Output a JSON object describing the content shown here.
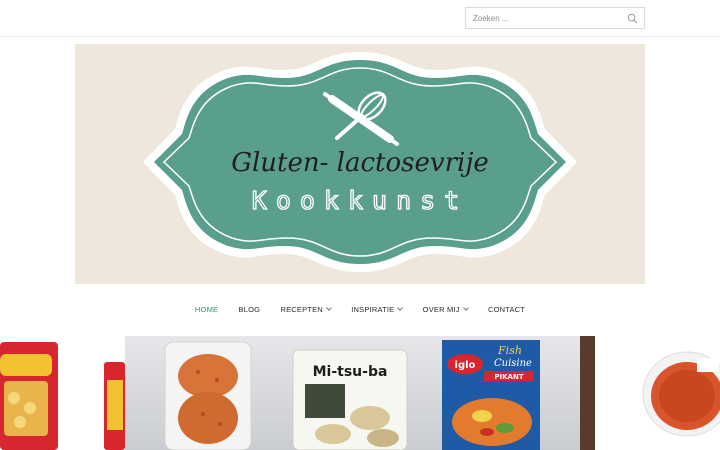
{
  "search": {
    "placeholder": "Zoeken ..."
  },
  "banner": {
    "line1": "Gluten- lactosevrije",
    "line2": "Kookkunst"
  },
  "nav": {
    "items": [
      {
        "label": "HOME",
        "dropdown": false,
        "active": true
      },
      {
        "label": "BLOG",
        "dropdown": false,
        "active": false
      },
      {
        "label": "RECEPTEN",
        "dropdown": true,
        "active": false
      },
      {
        "label": "INSPIRATIE",
        "dropdown": true,
        "active": false
      },
      {
        "label": "OVER MIJ",
        "dropdown": true,
        "active": false
      },
      {
        "label": "CONTACT",
        "dropdown": false,
        "active": false
      }
    ]
  },
  "products": {
    "mitsuba": "Mi-tsu-ba",
    "fish_brand": "Fish",
    "fish_sub": "Cuisine",
    "iglo": "iglo",
    "pikant": "PIKANT"
  },
  "colors": {
    "accent": "#2f8f7d",
    "badge": "#5a9e8e",
    "banner_bg": "#efe7dc"
  }
}
